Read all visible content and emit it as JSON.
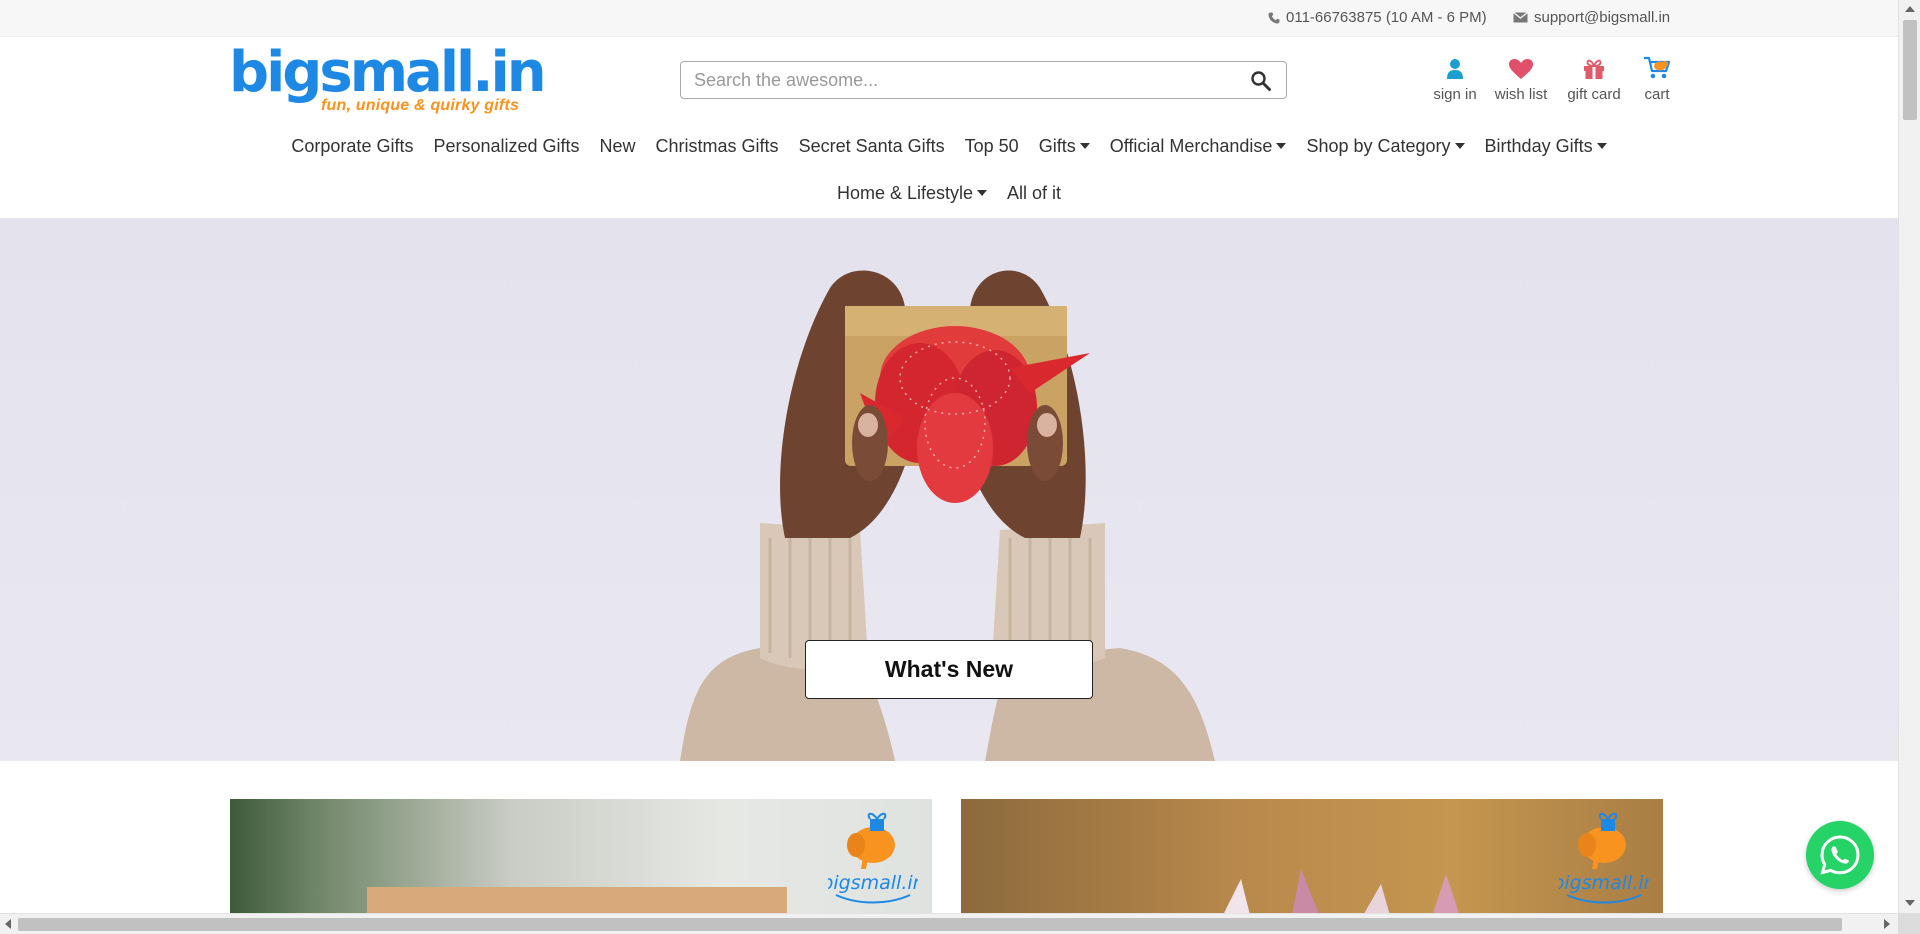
{
  "topbar": {
    "phone": "011-66763875 (10 AM - 6 PM)",
    "email": "support@bigsmall.in",
    "phone_icon": "phone-icon",
    "email_icon": "envelope-icon"
  },
  "logo": {
    "wordmark": "bigsmall.in",
    "tagline": "fun, unique & quirky gifts"
  },
  "search": {
    "placeholder": "Search the awesome...",
    "value": "",
    "icon": "search-icon"
  },
  "account": [
    {
      "label": "sign in",
      "icon": "user-icon"
    },
    {
      "label": "wish list",
      "icon": "heart-icon"
    },
    {
      "label": "gift card",
      "icon": "gift-icon"
    },
    {
      "label": "cart",
      "icon": "cart-icon"
    }
  ],
  "nav": {
    "row1": [
      {
        "label": "Corporate Gifts",
        "dropdown": false
      },
      {
        "label": "Personalized Gifts",
        "dropdown": false
      },
      {
        "label": "New",
        "dropdown": false
      },
      {
        "label": "Christmas Gifts",
        "dropdown": false
      },
      {
        "label": "Secret Santa Gifts",
        "dropdown": false
      },
      {
        "label": "Top 50",
        "dropdown": false
      },
      {
        "label": "Gifts",
        "dropdown": true
      },
      {
        "label": "Official Merchandise",
        "dropdown": true
      },
      {
        "label": "Shop by Category",
        "dropdown": true
      },
      {
        "label": "Birthday Gifts",
        "dropdown": true
      }
    ],
    "row2": [
      {
        "label": "Home & Lifestyle",
        "dropdown": true
      },
      {
        "label": "All of it",
        "dropdown": false
      }
    ]
  },
  "hero": {
    "button_label": "What's New"
  },
  "promo_cards": [
    {
      "brand": "bigsmall.in",
      "icon": "elephant-logo-icon"
    },
    {
      "brand": "bigsmall.in",
      "icon": "elephant-logo-icon"
    }
  ],
  "colors": {
    "brand_blue": "#1e88e5",
    "brand_orange": "#f7931e",
    "signin_icon": "#1a9fd0",
    "heart_icon": "#e0506a",
    "gift_icon": "#e05a6a",
    "whatsapp": "#25d366"
  },
  "whatsapp": {
    "icon": "whatsapp-icon"
  }
}
